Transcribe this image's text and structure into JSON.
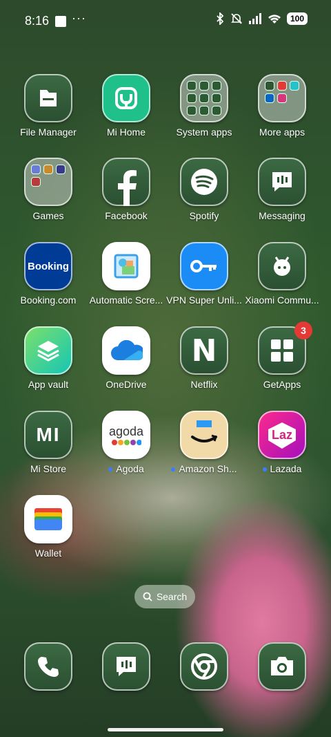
{
  "status_bar": {
    "time": "8:16",
    "battery": "100"
  },
  "apps": [
    {
      "label": "File Manager"
    },
    {
      "label": "Mi Home"
    },
    {
      "label": "System apps"
    },
    {
      "label": "More apps"
    },
    {
      "label": "Games"
    },
    {
      "label": "Facebook"
    },
    {
      "label": "Spotify"
    },
    {
      "label": "Messaging"
    },
    {
      "label": "Booking.com"
    },
    {
      "label": "Automatic Scre..."
    },
    {
      "label": "VPN Super Unli..."
    },
    {
      "label": "Xiaomi Commu..."
    },
    {
      "label": "App vault"
    },
    {
      "label": "OneDrive"
    },
    {
      "label": "Netflix"
    },
    {
      "label": "GetApps",
      "badge": "3"
    },
    {
      "label": "Mi Store"
    },
    {
      "label": "Agoda"
    },
    {
      "label": "Amazon Sh..."
    },
    {
      "label": "Lazada"
    },
    {
      "label": "Wallet"
    }
  ],
  "icon_text": {
    "booking": "Booking",
    "netflix": "N",
    "lazada": "Laz",
    "mistore": "MI",
    "agoda": "agoda"
  },
  "search": {
    "label": "Search"
  },
  "dock": [
    "phone-icon",
    "messaging-icon",
    "chrome-icon",
    "camera-icon"
  ]
}
